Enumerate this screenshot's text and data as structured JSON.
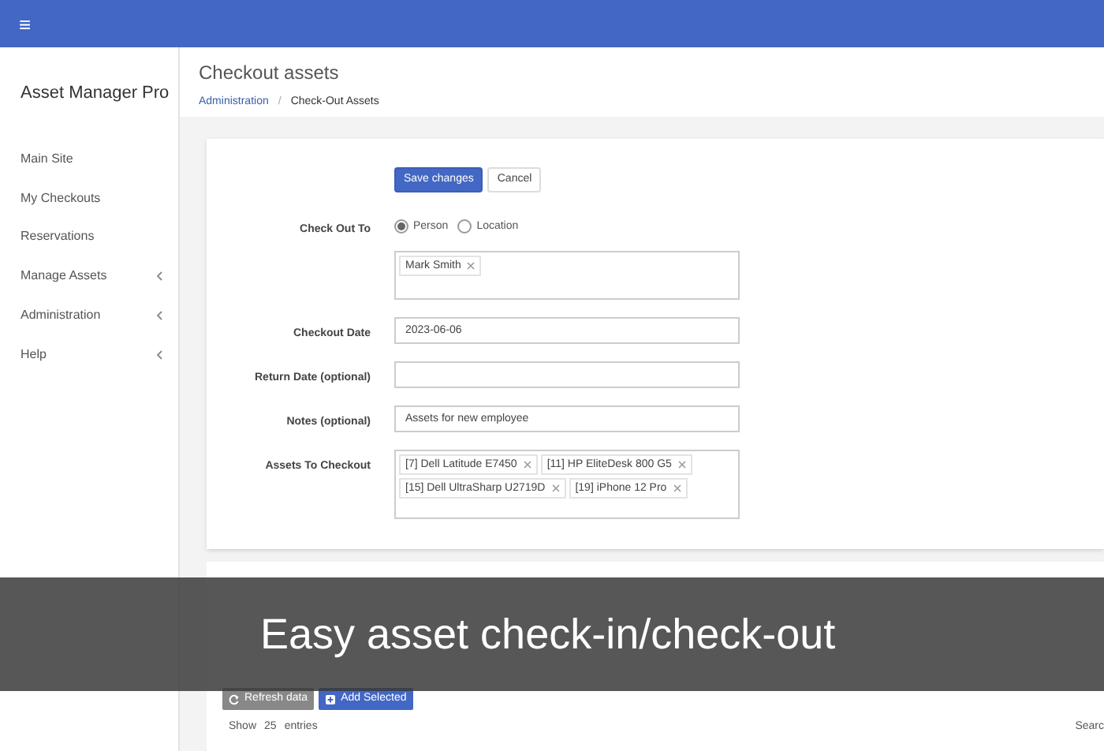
{
  "topbar": {
    "menu_icon": "≡"
  },
  "sidebar": {
    "title": "Asset Manager Pro",
    "items": [
      {
        "label": "Main Site",
        "expandable": false
      },
      {
        "label": "My Checkouts",
        "expandable": false
      },
      {
        "label": "Reservations",
        "expandable": false
      },
      {
        "label": "Manage Assets",
        "expandable": true
      },
      {
        "label": "Administration",
        "expandable": true
      },
      {
        "label": "Help",
        "expandable": true
      }
    ]
  },
  "header": {
    "title": "Checkout assets",
    "breadcrumb": [
      "Administration",
      "Check-Out Assets"
    ],
    "separator": "/"
  },
  "form": {
    "buttons": [
      {
        "label": "Save changes",
        "kind": "primary"
      },
      {
        "label": "Cancel",
        "kind": "secondary"
      }
    ],
    "check_out_to": {
      "label": "Check Out To",
      "options": [
        {
          "label": "Person",
          "selected": true
        },
        {
          "label": "Location",
          "selected": false
        }
      ],
      "tags": [
        "Mark Smith"
      ]
    },
    "fields": [
      {
        "label": "Checkout Date",
        "value": "2023-06-06",
        "kind": "text"
      },
      {
        "label": "Return Date (optional)",
        "kind": "text"
      },
      {
        "label": "Notes (optional)",
        "value": "Assets for new employee",
        "kind": "text"
      },
      {
        "label": "Assets To Checkout",
        "kind": "tags",
        "tags": [
          "[7] Dell Latitude E7450",
          "[11] HP EliteDesk 800 G5",
          "[15] Dell UltraSharp U2719D",
          "[19] iPhone 12 Pro"
        ]
      }
    ]
  },
  "available": {
    "buttons": [
      {
        "label": "Refresh data",
        "kind": "refresh"
      },
      {
        "label": "Add Selected",
        "kind": "add"
      }
    ],
    "show": {
      "prefix": "Show",
      "value": "25",
      "suffix": "entries"
    },
    "search_label": "Searc"
  },
  "caption": "Easy asset check-in/check-out"
}
